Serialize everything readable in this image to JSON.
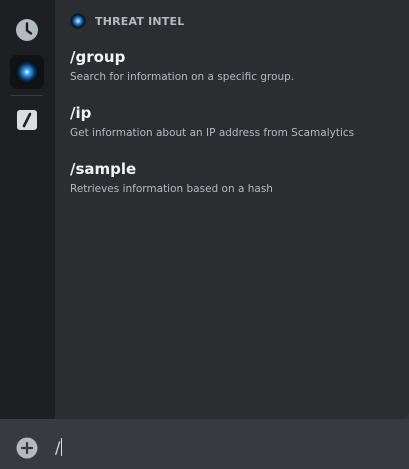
{
  "popup": {
    "section_title": "THREAT INTEL",
    "commands": [
      {
        "name": "/group",
        "description": "Search for information on a specific group."
      },
      {
        "name": "/ip",
        "description": "Get information about an IP address from Scamalytics"
      },
      {
        "name": "/sample",
        "description": "Retrieves information based on a hash"
      }
    ]
  },
  "rail": {
    "icons": [
      "clock-icon",
      "app-avatar-icon",
      "slash-command-icon"
    ]
  },
  "composer": {
    "input_value": "/",
    "add_icon": "plus-circle-icon"
  },
  "colors": {
    "popup_bg": "#2b2d31",
    "rail_bg": "#1e1f22",
    "composer_bg": "#383a40",
    "app_glow": "#3aa0ff"
  }
}
